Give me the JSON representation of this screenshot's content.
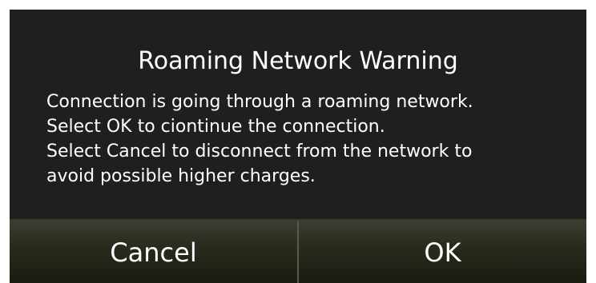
{
  "dialog": {
    "title": "Roaming Network Warning",
    "message_lines": [
      "Connection is going through a roaming network.",
      "Select OK to ciontinue the connection.",
      "Select Cancel to disconnect from the network to",
      "avoid possible higher charges."
    ],
    "buttons": {
      "cancel_label": "Cancel",
      "ok_label": "OK"
    }
  },
  "colors": {
    "dialog_background": "#1f1f1f",
    "text": "#ffffff",
    "button_divider": "#5a5a48"
  }
}
